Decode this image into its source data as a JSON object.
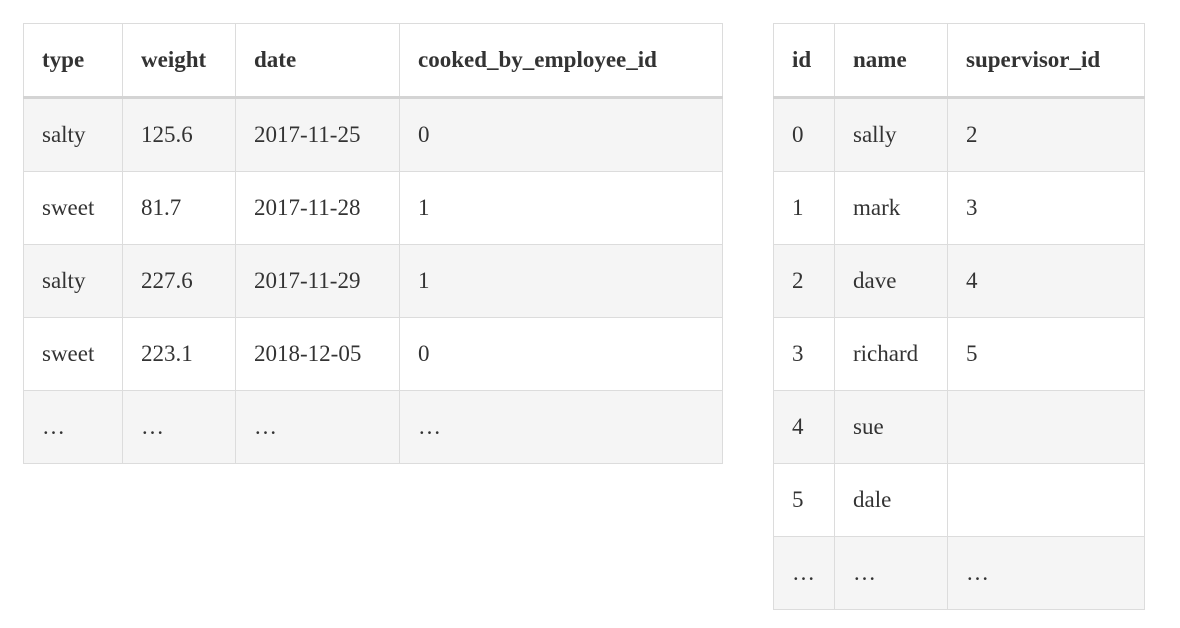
{
  "orders_table": {
    "headers": [
      "type",
      "weight",
      "date",
      "cooked_by_employee_id"
    ],
    "rows": [
      [
        "salty",
        "125.6",
        "2017-11-25",
        "0"
      ],
      [
        "sweet",
        "81.7",
        "2017-11-28",
        "1"
      ],
      [
        "salty",
        "227.6",
        "2017-11-29",
        "1"
      ],
      [
        "sweet",
        "223.1",
        "2018-12-05",
        "0"
      ],
      [
        "…",
        "…",
        "…",
        "…"
      ]
    ]
  },
  "employees_table": {
    "headers": [
      "id",
      "name",
      "supervisor_id"
    ],
    "rows": [
      [
        "0",
        "sally",
        "2"
      ],
      [
        "1",
        "mark",
        "3"
      ],
      [
        "2",
        "dave",
        "4"
      ],
      [
        "3",
        "richard",
        "5"
      ],
      [
        "4",
        "sue",
        ""
      ],
      [
        "5",
        "dale",
        ""
      ],
      [
        "…",
        "…",
        "…"
      ]
    ]
  }
}
